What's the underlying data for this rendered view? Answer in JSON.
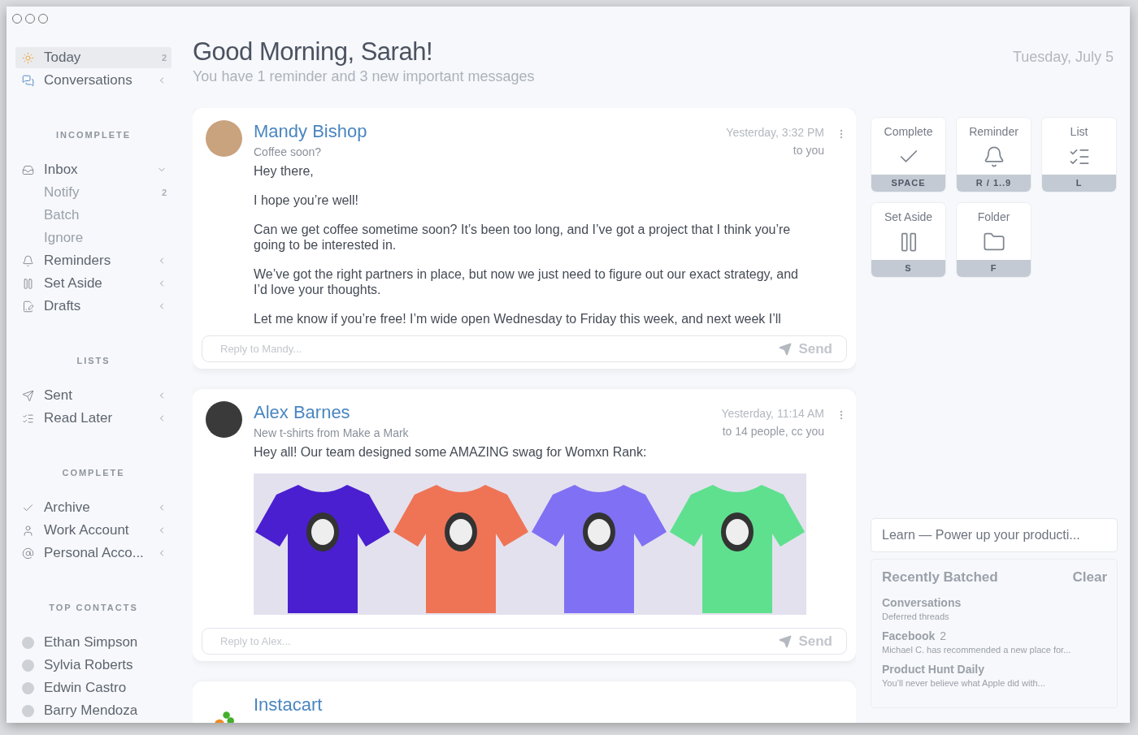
{
  "sidebar": {
    "top": [
      {
        "label": "Today",
        "count": "2",
        "selected": true
      },
      {
        "label": "Conversations",
        "expanded": false,
        "selected": false
      }
    ],
    "sections": [
      {
        "heading": "INCOMPLETE",
        "items": [
          {
            "label": "Inbox",
            "expanded": true,
            "selected": false,
            "children": [
              {
                "label": "Notify",
                "count": "2",
                "selected": false
              },
              {
                "label": "Batch",
                "selected": false
              },
              {
                "label": "Ignore",
                "selected": false
              }
            ]
          },
          {
            "label": "Reminders",
            "expanded": false,
            "selected": false
          },
          {
            "label": "Set Aside",
            "expanded": false,
            "selected": false
          },
          {
            "label": "Drafts",
            "expanded": false,
            "selected": false
          }
        ]
      },
      {
        "heading": "LISTS",
        "items": [
          {
            "label": "Sent",
            "expanded": false,
            "selected": false
          },
          {
            "label": "Read Later",
            "expanded": false,
            "selected": false
          }
        ]
      },
      {
        "heading": "COMPLETE",
        "items": [
          {
            "label": "Archive",
            "expanded": false,
            "selected": false
          },
          {
            "label": "Work Account",
            "expanded": false,
            "selected": false
          },
          {
            "label": "Personal Acco...",
            "expanded": false,
            "selected": false
          }
        ]
      }
    ],
    "contacts_heading": "TOP CONTACTS",
    "contacts": [
      {
        "name": "Ethan Simpson"
      },
      {
        "name": "Sylvia Roberts"
      },
      {
        "name": "Edwin Castro"
      },
      {
        "name": "Barry Mendoza"
      }
    ]
  },
  "header": {
    "title": "Good Morning, Sarah!",
    "subtitle": "You have 1 reminder and 3 new important messages",
    "date": "Tuesday, July 5"
  },
  "messages": [
    {
      "sender": "Mandy Bishop",
      "subject": "Coffee soon?",
      "time": "Yesterday, 3:32 PM",
      "recipients": "to you",
      "body": [
        "Hey there,",
        "I hope you’re well!",
        "Can we get coffee sometime soon? It’s been too long, and I’ve got a project that I think you’re going to be interested in.",
        "We’ve got the right partners in place, but now we just need to figure out our exact strategy, and I’d love your thoughts.",
        "Let me know if you’re free! I’m wide open Wednesday to Friday this week, and next week I’ll"
      ],
      "reply_placeholder": "Reply to Mandy...",
      "send": "Send"
    },
    {
      "sender": "Alex Barnes",
      "subject": "New t-shirts from Make a Mark",
      "time": "Yesterday, 11:14 AM",
      "recipients": "to 14 people, cc you",
      "body": [
        "Hey all! Our team designed some AMAZING swag for Womxn Rank:"
      ],
      "reply_placeholder": "Reply to Alex...",
      "send": "Send"
    },
    {
      "sender": "Instacart"
    }
  ],
  "actions": [
    {
      "label": "Complete",
      "shortcut": "SPACE"
    },
    {
      "label": "Reminder",
      "shortcut": "R / 1..9"
    },
    {
      "label": "List",
      "shortcut": "L"
    },
    {
      "label": "Set Aside",
      "shortcut": "S"
    },
    {
      "label": "Folder",
      "shortcut": "F"
    }
  ],
  "learn": "Learn — Power up your producti...",
  "recently_batched": {
    "title": "Recently Batched",
    "clear": "Clear",
    "items": [
      {
        "title": "Conversations",
        "preview": "Deferred threads"
      },
      {
        "title": "Facebook",
        "count": "2",
        "preview": "Michael C. has recommended a new place for..."
      },
      {
        "title": "Product Hunt Daily",
        "preview": "You’ll never believe what Apple did with..."
      }
    ]
  }
}
